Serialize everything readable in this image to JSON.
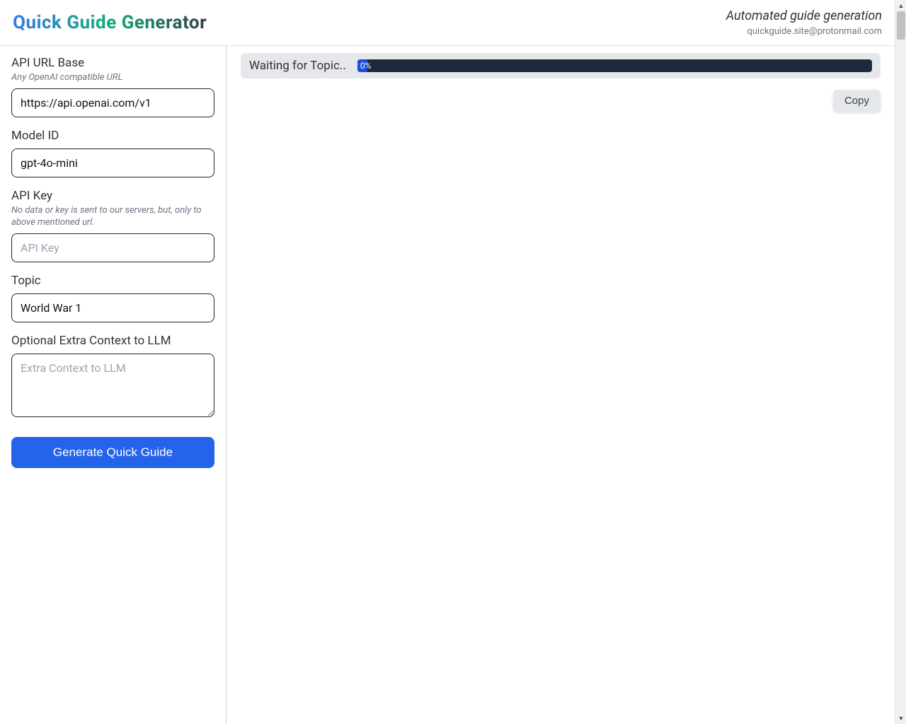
{
  "header": {
    "title": "Quick Guide Generator",
    "subtitle": "Automated guide generation",
    "contact": "quickguide.site@protonmail.com"
  },
  "sidebar": {
    "apiUrl": {
      "label": "API URL Base",
      "hint": "Any OpenAI compatible URL",
      "value": "https://api.openai.com/v1"
    },
    "modelId": {
      "label": "Model ID",
      "value": "gpt-4o-mini"
    },
    "apiKey": {
      "label": "API Key",
      "hint": "No data or key is sent to our servers, but, only to above mentioned url.",
      "placeholder": "API Key",
      "value": ""
    },
    "topic": {
      "label": "Topic",
      "value": "World War 1"
    },
    "extraContext": {
      "label": "Optional Extra Context to LLM",
      "placeholder": "Extra Context to LLM",
      "value": ""
    },
    "generateLabel": "Generate Quick Guide"
  },
  "content": {
    "statusText": "Waiting for Topic..",
    "progressLabel": "0%",
    "copyLabel": "Copy"
  }
}
